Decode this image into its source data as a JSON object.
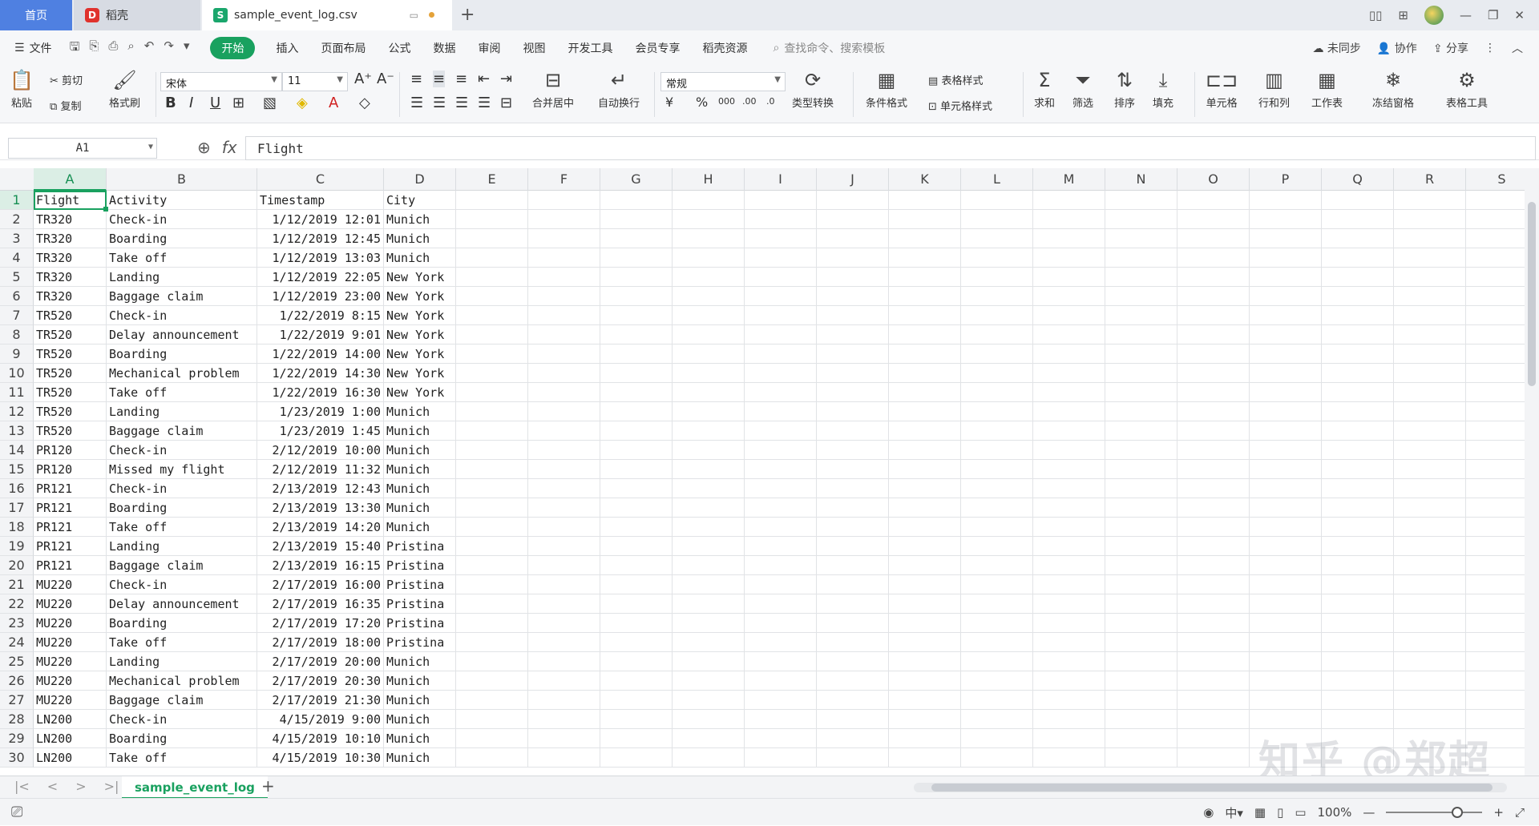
{
  "tabs": {
    "home": "首页",
    "docer": "稻壳",
    "docer_logo": "D",
    "file": "sample_event_log.csv",
    "file_logo": "S",
    "new_tab": "+"
  },
  "menu": {
    "file": "文件",
    "items": [
      "开始",
      "插入",
      "页面布局",
      "公式",
      "数据",
      "审阅",
      "视图",
      "开发工具",
      "会员专享",
      "稻壳资源"
    ],
    "search_placeholder": "查找命令、搜索模板",
    "sync": "未同步",
    "collab": "协作",
    "share": "分享"
  },
  "ribbon": {
    "paste": "粘贴",
    "cut": "剪切",
    "copy": "复制",
    "format_painter": "格式刷",
    "font_name": "宋体",
    "font_size": "11",
    "merge_center": "合并居中",
    "wrap_text": "自动换行",
    "number_format": "常规",
    "type_convert": "类型转换",
    "cond_format": "条件格式",
    "table_style": "表格样式",
    "cell_style": "单元格样式",
    "sum": "求和",
    "filter": "筛选",
    "sort": "排序",
    "fill": "填充",
    "cell": "单元格",
    "row_col": "行和列",
    "sheet": "工作表",
    "freeze": "冻结窗格",
    "table_tools": "表格工具"
  },
  "formula_bar": {
    "name_box": "A1",
    "fx": "fx",
    "content": "Flight"
  },
  "columns": [
    "A",
    "B",
    "C",
    "D",
    "E",
    "F",
    "G",
    "H",
    "I",
    "J",
    "K",
    "L",
    "M",
    "N",
    "O",
    "P",
    "Q",
    "R",
    "S"
  ],
  "row_numbers": [
    "1",
    "2",
    "3",
    "4",
    "5",
    "6",
    "7",
    "8",
    "9",
    "10",
    "11",
    "12",
    "13",
    "14",
    "15",
    "16",
    "17",
    "18",
    "19",
    "20",
    "21",
    "22",
    "23",
    "24",
    "25",
    "26",
    "27",
    "28",
    "29",
    "30"
  ],
  "table": {
    "headers": [
      "Flight",
      "Activity",
      "Timestamp",
      "City"
    ],
    "rows": [
      [
        "TR320",
        "Check-in",
        "1/12/2019 12:01",
        "Munich"
      ],
      [
        "TR320",
        "Boarding",
        "1/12/2019 12:45",
        "Munich"
      ],
      [
        "TR320",
        "Take off",
        "1/12/2019 13:03",
        "Munich"
      ],
      [
        "TR320",
        "Landing",
        "1/12/2019 22:05",
        "New York"
      ],
      [
        "TR320",
        "Baggage claim",
        "1/12/2019 23:00",
        "New York"
      ],
      [
        "TR520",
        "Check-in",
        "1/22/2019 8:15",
        "New York"
      ],
      [
        "TR520",
        "Delay announcement",
        "1/22/2019 9:01",
        "New York"
      ],
      [
        "TR520",
        "Boarding",
        "1/22/2019 14:00",
        "New York"
      ],
      [
        "TR520",
        "Mechanical problem",
        "1/22/2019 14:30",
        "New York"
      ],
      [
        "TR520",
        "Take off",
        "1/22/2019 16:30",
        "New York"
      ],
      [
        "TR520",
        "Landing",
        "1/23/2019 1:00",
        "Munich"
      ],
      [
        "TR520",
        "Baggage claim",
        "1/23/2019 1:45",
        "Munich"
      ],
      [
        "PR120",
        "Check-in",
        "2/12/2019 10:00",
        "Munich"
      ],
      [
        "PR120",
        "Missed my flight",
        "2/12/2019 11:32",
        "Munich"
      ],
      [
        "PR121",
        "Check-in",
        "2/13/2019 12:43",
        "Munich"
      ],
      [
        "PR121",
        "Boarding",
        "2/13/2019 13:30",
        "Munich"
      ],
      [
        "PR121",
        "Take off",
        "2/13/2019 14:20",
        "Munich"
      ],
      [
        "PR121",
        "Landing",
        "2/13/2019 15:40",
        "Pristina"
      ],
      [
        "PR121",
        "Baggage claim",
        "2/13/2019 16:15",
        "Pristina"
      ],
      [
        "MU220",
        "Check-in",
        "2/17/2019 16:00",
        "Pristina"
      ],
      [
        "MU220",
        "Delay announcement",
        "2/17/2019 16:35",
        "Pristina"
      ],
      [
        "MU220",
        "Boarding",
        "2/17/2019 17:20",
        "Pristina"
      ],
      [
        "MU220",
        "Take off",
        "2/17/2019 18:00",
        "Pristina"
      ],
      [
        "MU220",
        "Landing",
        "2/17/2019 20:00",
        "Munich"
      ],
      [
        "MU220",
        "Mechanical problem",
        "2/17/2019 20:30",
        "Munich"
      ],
      [
        "MU220",
        "Baggage claim",
        "2/17/2019 21:30",
        "Munich"
      ],
      [
        "LN200",
        "Check-in",
        "4/15/2019 9:00",
        "Munich"
      ],
      [
        "LN200",
        "Boarding",
        "4/15/2019 10:10",
        "Munich"
      ],
      [
        "LN200",
        "Take off",
        "4/15/2019 10:30",
        "Munich"
      ]
    ]
  },
  "sheet_tab": "sample_event_log",
  "status": {
    "zoom": "100%"
  },
  "watermark": "知乎 @郑超",
  "colors": {
    "accent": "#19a15f",
    "home_tab": "#4f80e1"
  }
}
